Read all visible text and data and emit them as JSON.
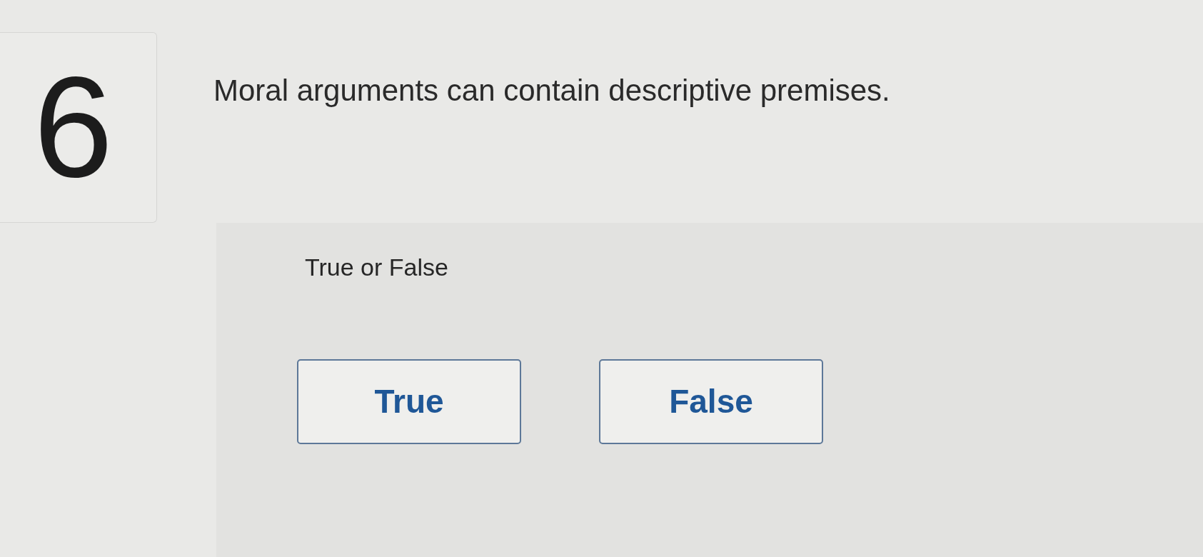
{
  "question": {
    "number": "6",
    "text": "Moral arguments can contain descriptive premises."
  },
  "answer": {
    "prompt": "True or False",
    "options": [
      {
        "label": "True",
        "selected": false
      },
      {
        "label": "False",
        "selected": false
      }
    ]
  }
}
